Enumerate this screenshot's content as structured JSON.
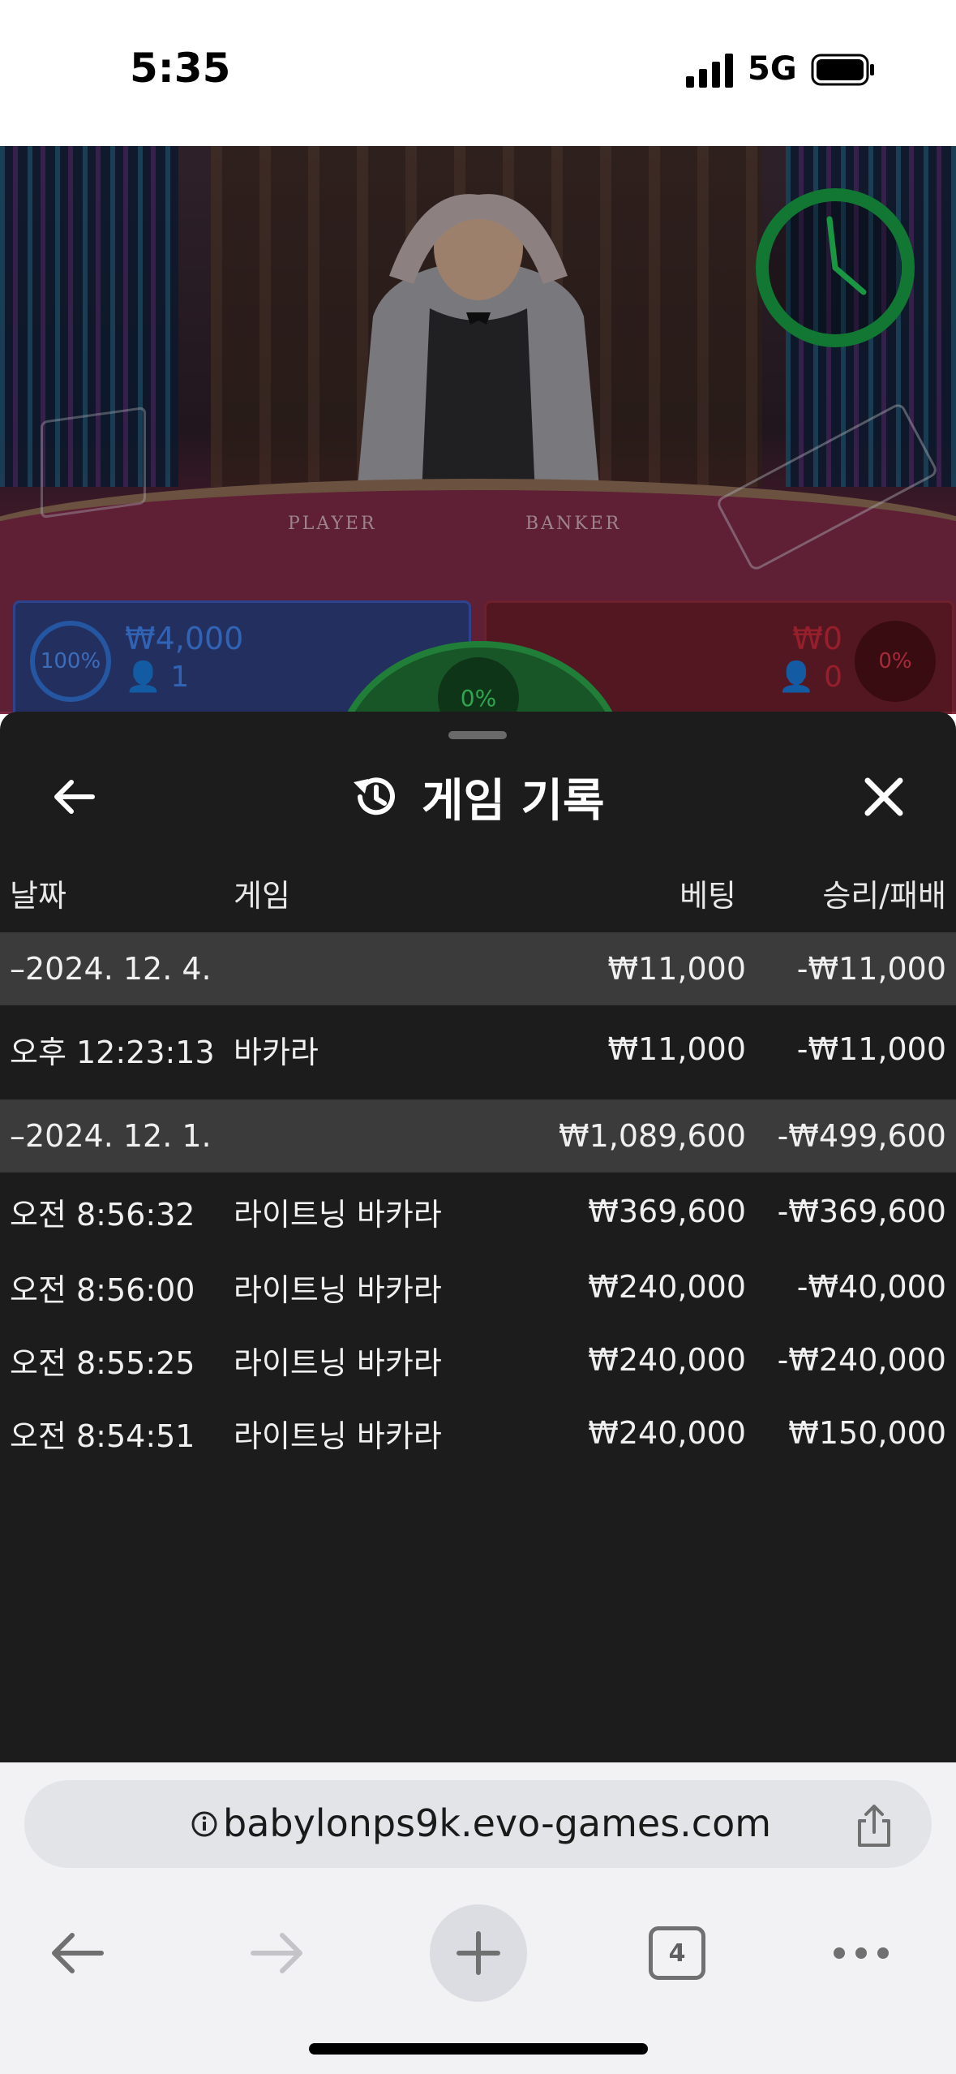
{
  "status_bar": {
    "time": "5:35",
    "network": "5G"
  },
  "video": {
    "table_label_player": "PLAYER",
    "table_label_banker": "BANKER",
    "player_bet": {
      "percent": "100%",
      "amount": "₩4,000",
      "count": "1",
      "color": "#3f7fe8"
    },
    "banker_bet": {
      "percent": "0%",
      "amount": "₩0",
      "count": "0",
      "color": "#c02838"
    },
    "tie_bet": {
      "percent": "0%",
      "color": "#2aa24a"
    }
  },
  "history": {
    "title": "게임 기록",
    "columns": {
      "date": "날짜",
      "game": "게임",
      "bet": "베팅",
      "win_loss": "승리/패배"
    },
    "groups": [
      {
        "date": "–2024. 12. 4.",
        "bet": "₩11,000",
        "win_loss": "-₩11,000",
        "items": [
          {
            "time": "오후 12:23:13",
            "game": "바카라",
            "bet": "₩11,000",
            "win_loss": "-₩11,000"
          }
        ]
      },
      {
        "date": "–2024. 12. 1.",
        "bet": "₩1,089,600",
        "win_loss": "-₩499,600",
        "items": [
          {
            "time": "오전 8:56:32",
            "game": "라이트닝 바카라",
            "bet": "₩369,600",
            "win_loss": "-₩369,600"
          },
          {
            "time": "오전 8:56:00",
            "game": "라이트닝 바카라",
            "bet": "₩240,000",
            "win_loss": "-₩40,000"
          },
          {
            "time": "오전 8:55:25",
            "game": "라이트닝 바카라",
            "bet": "₩240,000",
            "win_loss": "-₩240,000"
          },
          {
            "time": "오전 8:54:51",
            "game": "라이트닝 바카라",
            "bet": "₩240,000",
            "win_loss": "₩150,000"
          }
        ]
      }
    ]
  },
  "browser": {
    "url": "babylonps9k.evo-games.com",
    "open_tabs": "4"
  }
}
